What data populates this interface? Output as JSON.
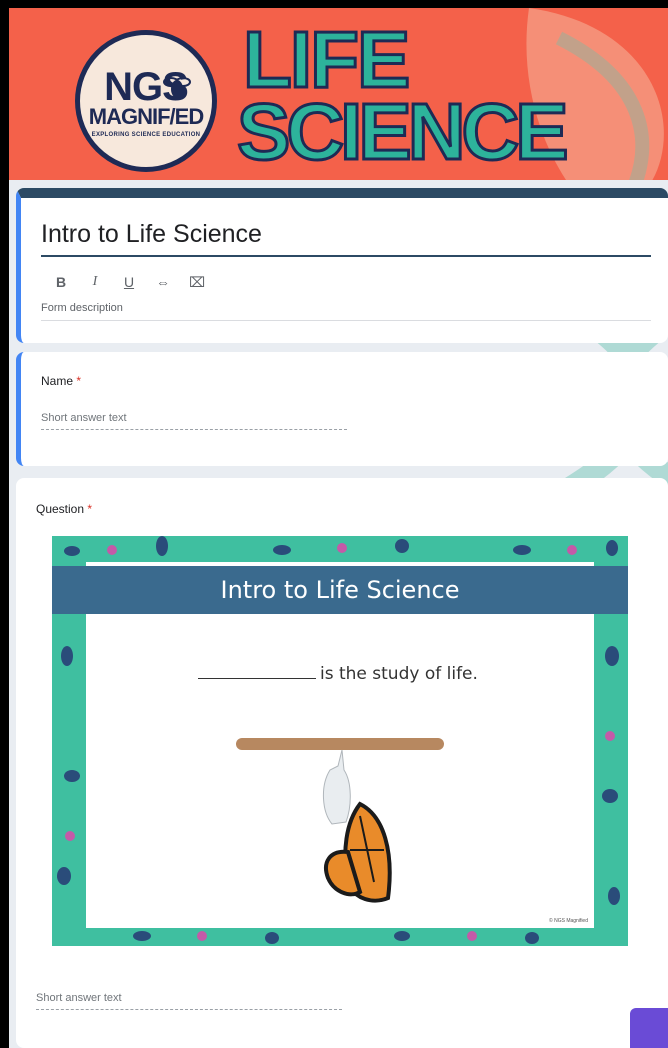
{
  "banner": {
    "logo_main": "NGS",
    "logo_sub": "MAGNIF/ED",
    "logo_tagline": "EXPLORING SCIENCE EDUCATION",
    "title_line1": "LIFE",
    "title_line2": "SCIENCE"
  },
  "form": {
    "title": "Intro to Life Science",
    "toolbar": [
      "B",
      "I",
      "U",
      "⇔",
      "⌧"
    ],
    "description_placeholder": "Form description"
  },
  "questions": [
    {
      "label": "Name",
      "required_mark": "*",
      "placeholder": "Short answer text"
    },
    {
      "label": "Question",
      "required_mark": "*",
      "placeholder": "Short answer text"
    }
  ],
  "slide": {
    "title": "Intro to Life Science",
    "sentence": "is the study of life.",
    "copyright": "© NGS Magnified"
  },
  "colors": {
    "banner": "#f4614a",
    "accent": "#4285f4",
    "header_bar": "#2c4a64",
    "slide_title_bg": "#3a6a8e"
  }
}
